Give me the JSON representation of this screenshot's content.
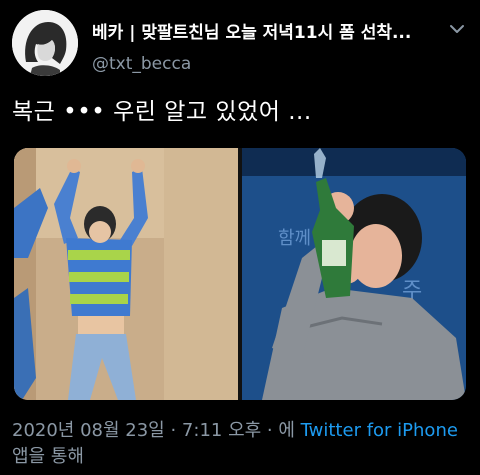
{
  "header": {
    "display_name": "베카 | 맞팔트친님 오늘 저녁11시 폼 선착...",
    "handle": "@txt_becca",
    "menu_icon": "chevron-down-icon"
  },
  "tweet": {
    "text": "복근 ••• 우린 알고 있었어 ..."
  },
  "media": {
    "left_alt": "dancer in striped sweater",
    "right_alt": "woman with bottle"
  },
  "meta": {
    "date": "2020년 08월 23일",
    "separator": " · ",
    "time": "7:11 오후",
    "via_prefix": " · 에 ",
    "source": "Twitter for iPhone",
    "via_suffix": " 앱을 통해"
  },
  "colors": {
    "background": "#000000",
    "text": "#ffffff",
    "secondary": "#8b98a5",
    "accent": "#1d9bf0"
  }
}
